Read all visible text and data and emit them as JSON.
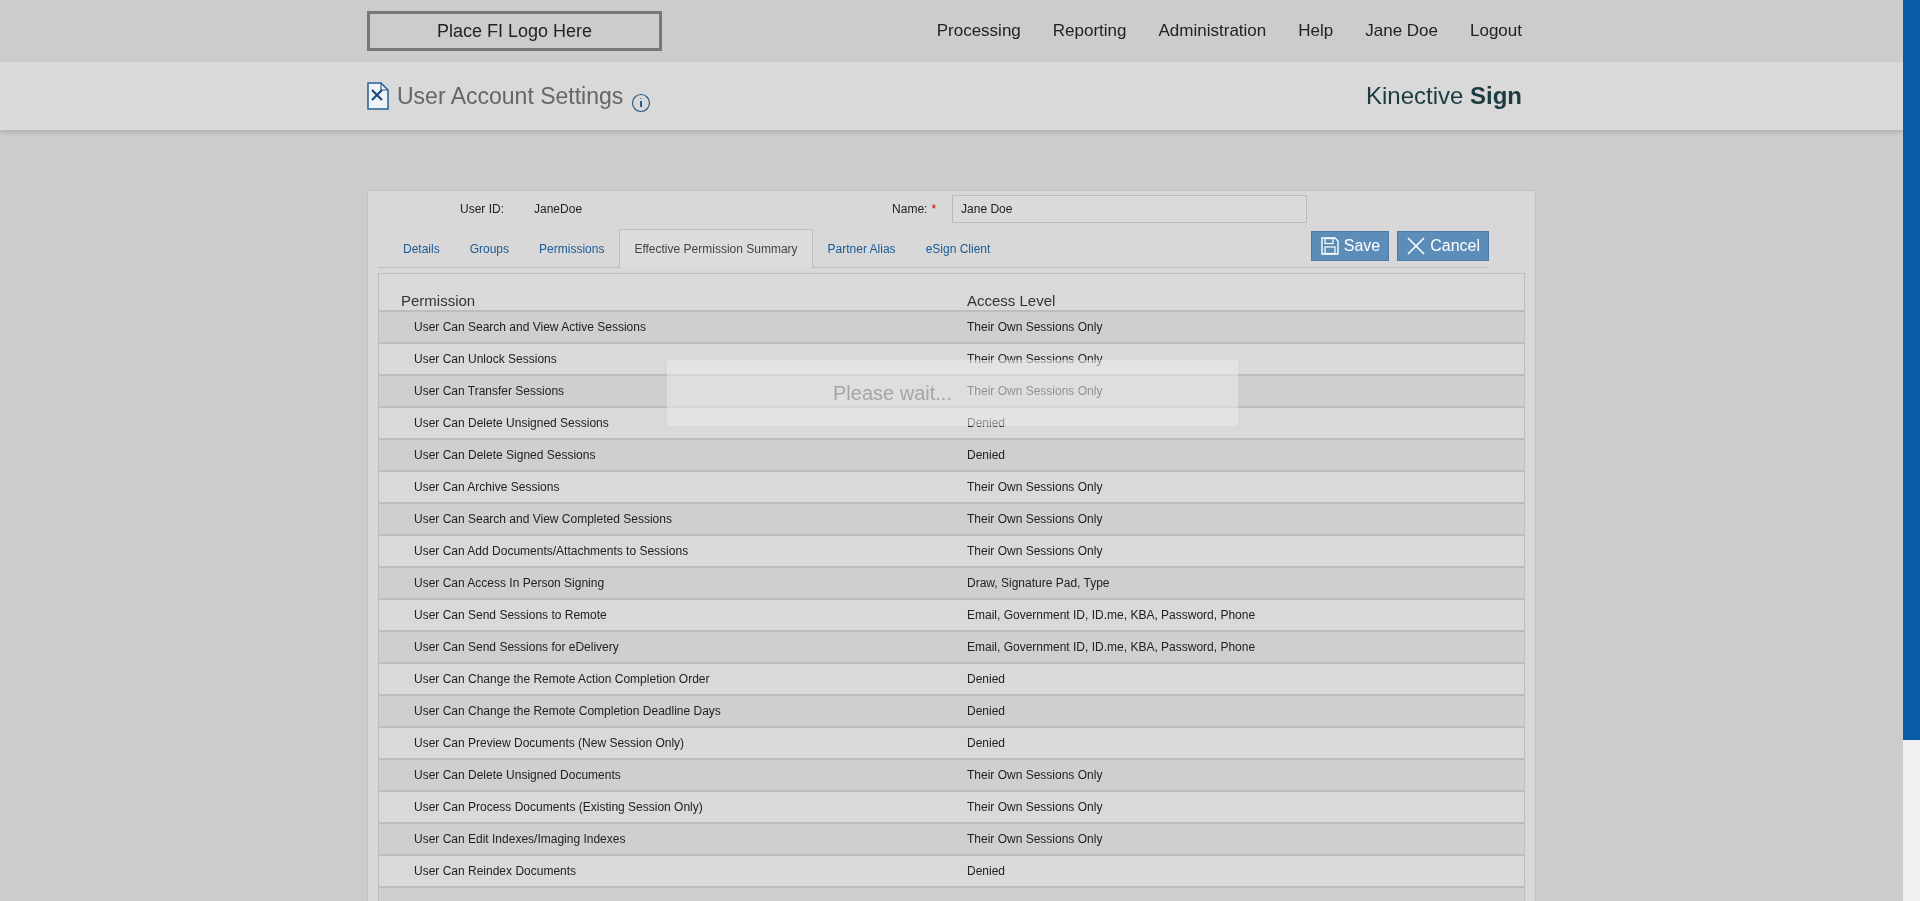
{
  "logo_placeholder": "Place FI Logo Here",
  "nav": [
    "Processing",
    "Reporting",
    "Administration",
    "Help",
    "Jane Doe",
    "Logout"
  ],
  "page_title": "User Account Settings",
  "brand": {
    "light": "Kinective",
    "bold": "Sign"
  },
  "user": {
    "id_label": "User ID:",
    "id_value": "JaneDoe",
    "name_label": "Name:",
    "required_mark": "*",
    "name_value": "Jane Doe"
  },
  "tabs": [
    {
      "label": "Details",
      "selected": false
    },
    {
      "label": "Groups",
      "selected": false
    },
    {
      "label": "Permissions",
      "selected": false
    },
    {
      "label": "Effective Permission Summary",
      "selected": true
    },
    {
      "label": "Partner Alias",
      "selected": false
    },
    {
      "label": "eSign Client",
      "selected": false
    }
  ],
  "buttons": [
    {
      "kind": "save",
      "label": "Save"
    },
    {
      "kind": "cancel",
      "label": "Cancel"
    }
  ],
  "table": {
    "columns": [
      "Permission",
      "Access Level"
    ],
    "rows": [
      [
        "User Can Search and View Active Sessions",
        "Their Own Sessions Only"
      ],
      [
        "User Can Unlock Sessions",
        "Their Own Sessions Only"
      ],
      [
        "User Can Transfer Sessions",
        "Their Own Sessions Only"
      ],
      [
        "User Can Delete Unsigned Sessions",
        "Denied"
      ],
      [
        "User Can Delete Signed Sessions",
        "Denied"
      ],
      [
        "User Can Archive Sessions",
        "Their Own Sessions Only"
      ],
      [
        "User Can Search and View Completed Sessions",
        "Their Own Sessions Only"
      ],
      [
        "User Can Add Documents/Attachments to Sessions",
        "Their Own Sessions Only"
      ],
      [
        "User Can Access In Person Signing",
        "Draw, Signature Pad, Type"
      ],
      [
        "User Can Send Sessions to Remote",
        "Email, Government ID, ID.me, KBA, Password, Phone"
      ],
      [
        "User Can Send Sessions for eDelivery",
        "Email, Government ID, ID.me, KBA, Password, Phone"
      ],
      [
        "User Can Change the Remote Action Completion Order",
        "Denied"
      ],
      [
        "User Can Change the Remote Completion Deadline Days",
        "Denied"
      ],
      [
        "User Can Preview Documents (New Session Only)",
        "Denied"
      ],
      [
        "User Can Delete Unsigned Documents",
        "Their Own Sessions Only"
      ],
      [
        "User Can Process Documents (Existing Session Only)",
        "Their Own Sessions Only"
      ],
      [
        "User Can Edit Indexes/Imaging Indexes",
        "Their Own Sessions Only"
      ],
      [
        "User Can Reindex Documents",
        "Denied"
      ]
    ]
  },
  "overlay": {
    "message": "Please wait..."
  }
}
